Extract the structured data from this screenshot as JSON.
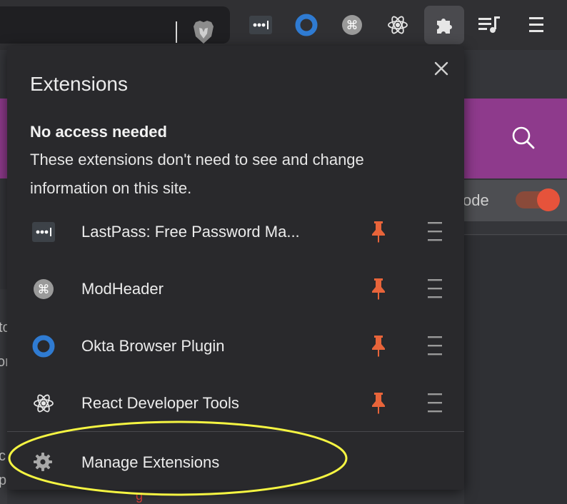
{
  "toolbar": {
    "icons": [
      "brave-lion-icon",
      "lastpass-icon",
      "okta-icon",
      "modheader-icon",
      "react-icon",
      "extensions-puzzle-icon",
      "media-queue-icon",
      "menu-icon"
    ]
  },
  "background_page": {
    "toggle_label": "ode",
    "left_fragments": [
      "to",
      "or",
      "c",
      "p"
    ]
  },
  "popup": {
    "title": "Extensions",
    "section_title": "No access needed",
    "section_description": "These extensions don't need to see and change information on this site.",
    "extensions": [
      {
        "name": "LastPass: Free Password Ma...",
        "icon": "lastpass-icon",
        "pinned": true
      },
      {
        "name": "ModHeader",
        "icon": "modheader-icon",
        "pinned": true
      },
      {
        "name": "Okta Browser Plugin",
        "icon": "okta-icon",
        "pinned": true
      },
      {
        "name": "React Developer Tools",
        "icon": "react-icon",
        "pinned": true
      }
    ],
    "manage_label": "Manage Extensions",
    "highlight_color": "#f5f542"
  },
  "colors": {
    "pin": "#e8643a",
    "purple_banner": "#8e3a8c",
    "okta_blue": "#2f7bd2"
  }
}
